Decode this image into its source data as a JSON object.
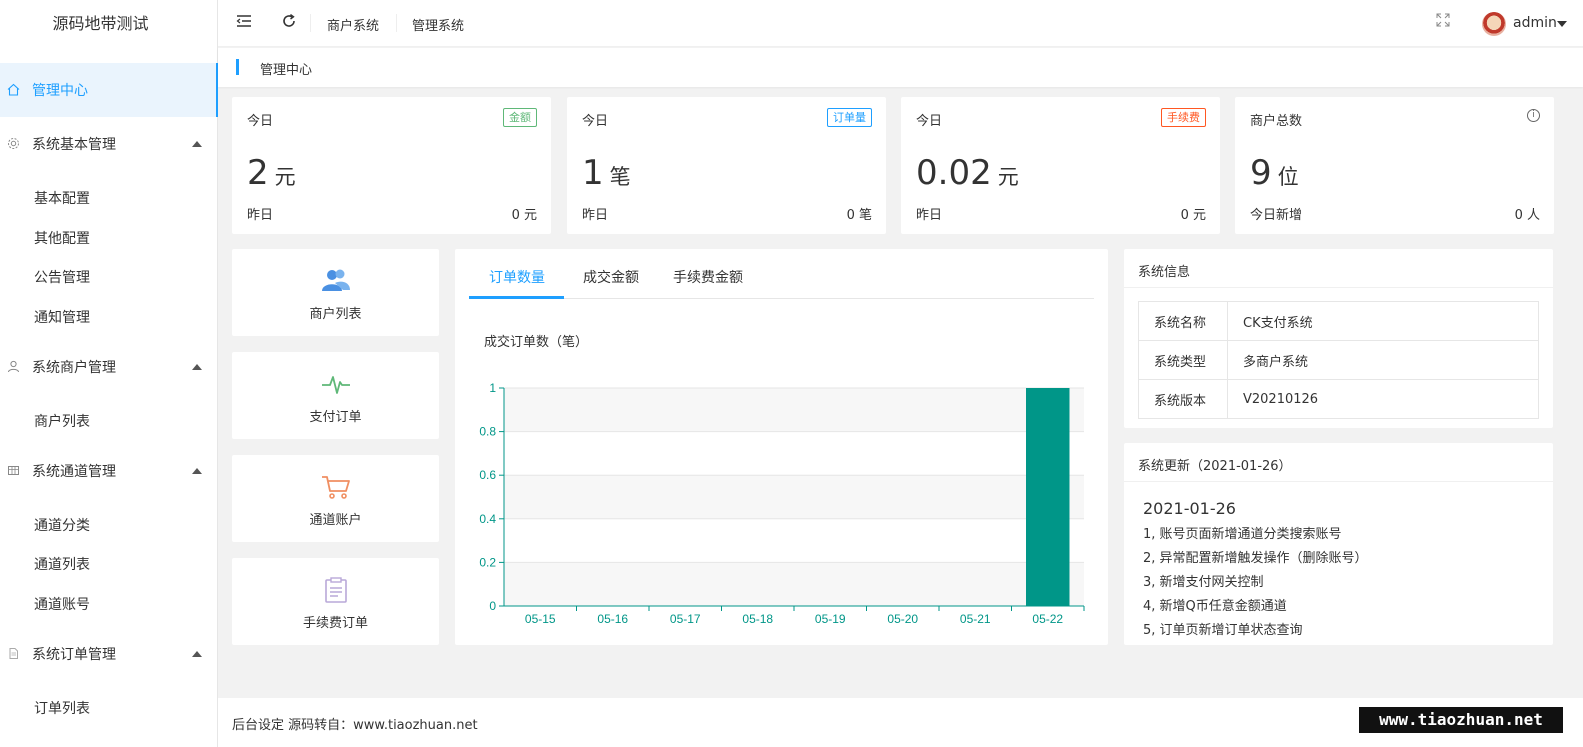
{
  "sidebar": {
    "logo": "源码地带测试",
    "active": "管理中心",
    "groups": [
      {
        "label": "系统基本管理",
        "items": [
          "基本配置",
          "其他配置",
          "公告管理",
          "通知管理"
        ]
      },
      {
        "label": "系统商户管理",
        "items": [
          "商户列表"
        ]
      },
      {
        "label": "系统通道管理",
        "items": [
          "通道分类",
          "通道列表",
          "通道账号"
        ]
      },
      {
        "label": "系统订单管理",
        "items": [
          "订单列表"
        ]
      }
    ]
  },
  "header": {
    "links": [
      "商户系统",
      "管理系统"
    ],
    "user": "admin"
  },
  "breadcrumb": "管理中心",
  "stats": [
    {
      "label": "今日",
      "tag": "金额",
      "tag_color": "#5fb878",
      "value": "2",
      "unit": "元",
      "sub_label": "昨日",
      "sub_value": "0 元"
    },
    {
      "label": "今日",
      "tag": "订单量",
      "tag_color": "#1e9fff",
      "value": "1",
      "unit": "笔",
      "sub_label": "昨日",
      "sub_value": "0 笔"
    },
    {
      "label": "今日",
      "tag": "手续费",
      "tag_color": "#ff5722",
      "value": "0.02",
      "unit": "元",
      "sub_label": "昨日",
      "sub_value": "0 元"
    },
    {
      "label": "商户总数",
      "value": "9",
      "unit": "位",
      "sub_label": "今日新增",
      "sub_value": "0 人"
    }
  ],
  "quick_links": [
    {
      "label": "商户列表",
      "icon": "users-icon",
      "color": "#4a90e2"
    },
    {
      "label": "支付订单",
      "icon": "pulse-icon",
      "color": "#5fb878"
    },
    {
      "label": "通道账户",
      "icon": "cart-icon",
      "color": "#f08f62"
    },
    {
      "label": "手续费订单",
      "icon": "clipboard-icon",
      "color": "#b9a8d8"
    }
  ],
  "chart_panel": {
    "tabs": [
      "订单数量",
      "成交金额",
      "手续费金额"
    ],
    "active_tab": 0
  },
  "chart_data": {
    "type": "bar",
    "title": "成交订单数（笔）",
    "categories": [
      "05-15",
      "05-16",
      "05-17",
      "05-18",
      "05-19",
      "05-20",
      "05-21",
      "05-22"
    ],
    "values": [
      0,
      0,
      0,
      0,
      0,
      0,
      0,
      1
    ],
    "ylim": [
      0,
      1
    ],
    "yticks": [
      "0",
      "0.2",
      "0.4",
      "0.6",
      "0.8",
      "1"
    ],
    "color": "#009688",
    "axis_color": "#009688"
  },
  "sysinfo": {
    "title": "系统信息",
    "rows": [
      {
        "k": "系统名称",
        "v": "CK支付系统"
      },
      {
        "k": "系统类型",
        "v": "多商户系统"
      },
      {
        "k": "系统版本",
        "v": "V20210126"
      }
    ]
  },
  "updates": {
    "title": "系统更新（2021-01-26）",
    "date": "2021-01-26",
    "items": [
      "1, 账号页面新增通道分类搜索账号",
      "2, 异常配置新增触发操作（删除账号）",
      "3, 新增支付网关控制",
      "4, 新增Q币任意金额通道",
      "5, 订单页新增订单状态查询"
    ]
  },
  "footer": "后台设定 源码转自：www.tiaozhuan.net",
  "watermark": "www.tiaozhuan.net"
}
